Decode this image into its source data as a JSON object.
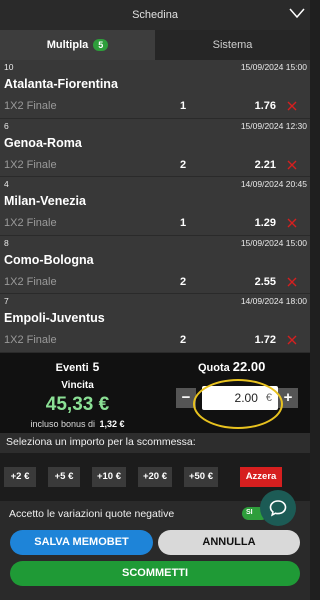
{
  "header": {
    "title": "Schedina"
  },
  "tabs": [
    {
      "label": "Multipla",
      "badge": "5"
    },
    {
      "label": "Sistema"
    }
  ],
  "bets": [
    {
      "code": "10",
      "datetime": "15/09/2024 15:00",
      "match": "Atalanta-Fiorentina",
      "market": "1X2 Finale",
      "sign": "1",
      "odd": "1.76"
    },
    {
      "code": "6",
      "datetime": "15/09/2024 12:30",
      "match": "Genoa-Roma",
      "market": "1X2 Finale",
      "sign": "2",
      "odd": "2.21"
    },
    {
      "code": "4",
      "datetime": "14/09/2024 20:45",
      "match": "Milan-Venezia",
      "market": "1X2 Finale",
      "sign": "1",
      "odd": "1.29"
    },
    {
      "code": "8",
      "datetime": "15/09/2024 15:00",
      "match": "Como-Bologna",
      "market": "1X2 Finale",
      "sign": "2",
      "odd": "2.55"
    },
    {
      "code": "7",
      "datetime": "14/09/2024 18:00",
      "match": "Empoli-Juventus",
      "market": "1X2 Finale",
      "sign": "2",
      "odd": "1.72"
    }
  ],
  "summary": {
    "eventi_label": "Eventi",
    "eventi_value": "5",
    "vincita_label": "Vincita",
    "vincita_value": "45,33 €",
    "bonus_label": "incluso bonus di",
    "bonus_value": "1,32 €",
    "quota_label": "Quota",
    "quota_value": "22.00",
    "stake_value": "2.00",
    "stake_currency": "€",
    "minus": "−",
    "plus": "+"
  },
  "amounts": {
    "label": "Seleziona un importo per la scommessa:",
    "options": [
      "+2 €",
      "+5 €",
      "+10 €",
      "+20 €",
      "+50 €"
    ],
    "reset": "Azzera"
  },
  "accept": {
    "label": "Accetto le variazioni quote negative",
    "toggle": "SI"
  },
  "actions": {
    "memobet": "SALVA MEMOBET",
    "annulla": "ANNULLA",
    "scommetti": "SCOMMETTI"
  },
  "colors": {
    "accent_green": "#2e9e3b",
    "win_green": "#8be095",
    "remove_red": "#d61f1f",
    "memobet_blue": "#1e84d8",
    "highlight": "#e8c21f"
  }
}
